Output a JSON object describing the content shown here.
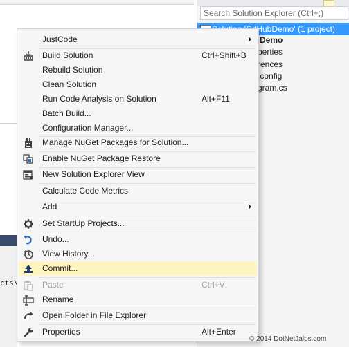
{
  "editor": {
    "code_fragment": "cts\\G"
  },
  "solution_explorer": {
    "search_placeholder": "Search Solution Explorer (Ctrl+;)",
    "solution_label": "Solution 'GitHubDemo' (1 project)",
    "items": [
      "Demo",
      "perties",
      "rences",
      ".config",
      "gram.cs"
    ]
  },
  "context_menu": {
    "items": [
      {
        "label": "JustCode",
        "submenu": true
      },
      {
        "label": "Build Solution",
        "shortcut": "Ctrl+Shift+B",
        "icon": "build-icon"
      },
      {
        "label": "Rebuild Solution"
      },
      {
        "label": "Clean Solution"
      },
      {
        "label": "Run Code Analysis on Solution",
        "shortcut": "Alt+F11"
      },
      {
        "label": "Batch Build..."
      },
      {
        "label": "Configuration Manager..."
      },
      {
        "label": "Manage NuGet Packages for Solution...",
        "icon": "nuget-icon"
      },
      {
        "label": "Enable NuGet Package Restore",
        "icon": "package-restore-icon"
      },
      {
        "label": "New Solution Explorer View",
        "icon": "new-view-icon"
      },
      {
        "label": "Calculate Code Metrics"
      },
      {
        "label": "Add",
        "submenu": true
      },
      {
        "label": "Set StartUp Projects...",
        "icon": "gear-icon"
      },
      {
        "label": "Undo...",
        "icon": "undo-icon"
      },
      {
        "label": "View History...",
        "icon": "history-icon"
      },
      {
        "label": "Commit...",
        "icon": "commit-icon",
        "highlighted": true
      },
      {
        "label": "Paste",
        "shortcut": "Ctrl+V",
        "icon": "paste-icon",
        "disabled": true
      },
      {
        "label": "Rename",
        "icon": "rename-icon"
      },
      {
        "label": "Open Folder in File Explorer",
        "icon": "open-folder-icon"
      },
      {
        "label": "Properties",
        "shortcut": "Alt+Enter",
        "icon": "wrench-icon"
      }
    ]
  },
  "watermark": "© 2014 DotNetJalps.com",
  "colors": {
    "highlight": "#fdf4bf",
    "selection": "#3399ff",
    "disabled_text": "#a2a4a5"
  }
}
